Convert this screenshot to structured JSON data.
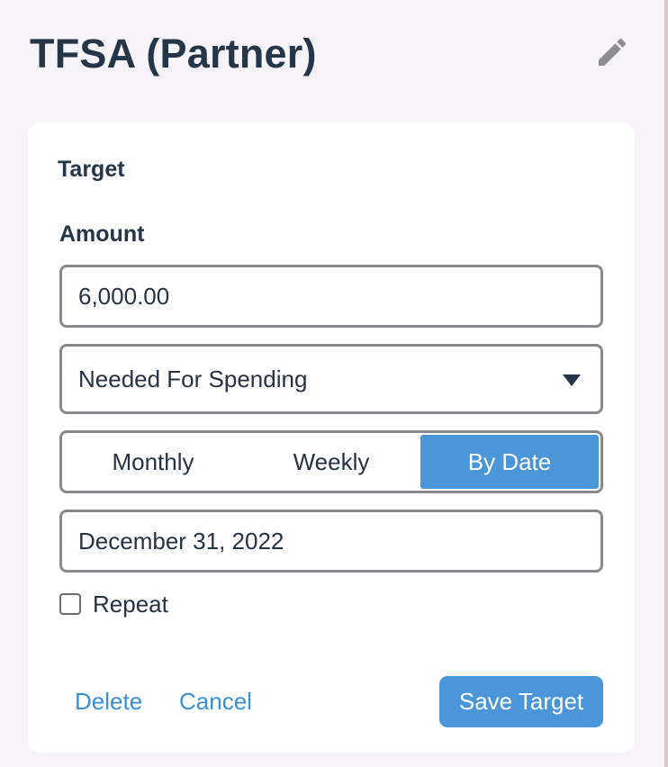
{
  "header": {
    "title": "TFSA (Partner)",
    "edit_icon": "pencil-icon"
  },
  "target": {
    "section_title": "Target",
    "amount_label": "Amount",
    "amount_value": "6,000.00",
    "type_select": {
      "selected": "Needed For Spending"
    },
    "frequency": {
      "options": [
        "Monthly",
        "Weekly",
        "By Date"
      ],
      "selected": "By Date"
    },
    "date_value": "December 31, 2022",
    "repeat": {
      "label": "Repeat",
      "checked": false
    }
  },
  "actions": {
    "delete_label": "Delete",
    "cancel_label": "Cancel",
    "save_label": "Save Target"
  },
  "colors": {
    "accent": "#4a96d9",
    "link": "#3b8fd4",
    "title": "#263649",
    "background": "#f6f4f8"
  }
}
